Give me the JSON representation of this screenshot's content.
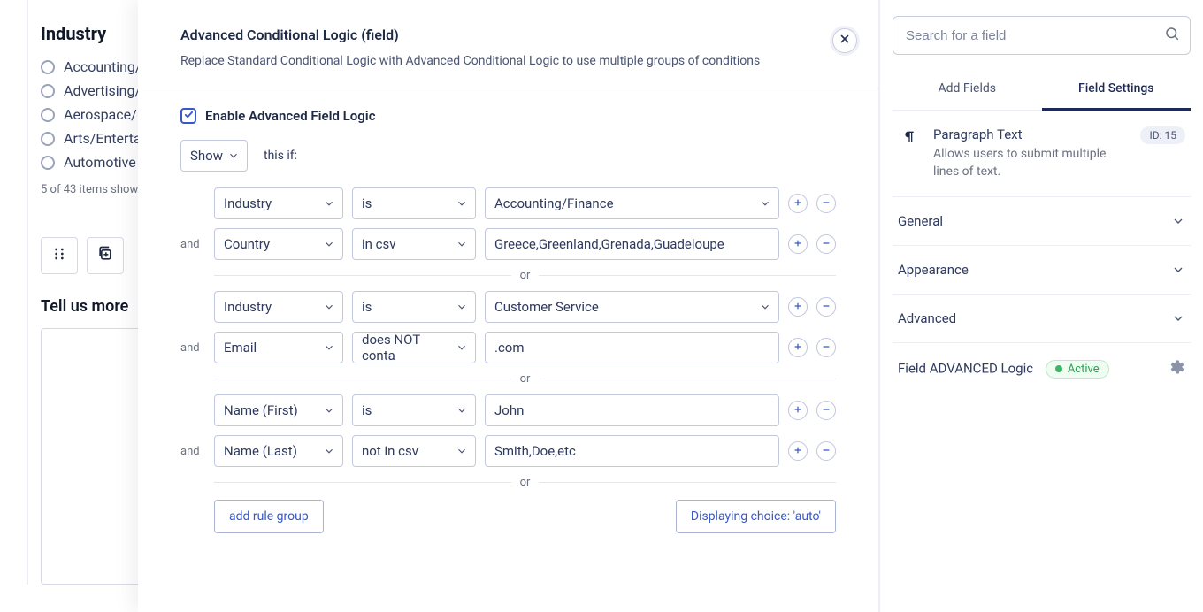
{
  "left": {
    "title": "Industry",
    "options": [
      "Accounting/",
      "Advertising/",
      "Aerospace/",
      "Arts/Enterta",
      "Automotive"
    ],
    "items_shown": "5 of 43 items shown.",
    "tell_more": "Tell us more"
  },
  "modal": {
    "title": "Advanced Conditional Logic (field)",
    "subtitle": "Replace Standard Conditional Logic with Advanced Conditional Logic to use multiple groups of conditions",
    "enable_label": "Enable Advanced Field Logic",
    "show_label": "Show",
    "this_if": "this if:",
    "and_label": "and",
    "or_label": "or",
    "rules": [
      {
        "field": "Industry",
        "op": "is",
        "value": "Accounting/Finance",
        "value_type": "select"
      },
      {
        "field": "Country",
        "op": "in csv",
        "value": "Greece,Greenland,Grenada,Guadeloupe",
        "value_type": "text",
        "and": true
      },
      {
        "field": "Industry",
        "op": "is",
        "value": "Customer Service",
        "value_type": "select"
      },
      {
        "field": "Email",
        "op": "does NOT conta",
        "value": ".com",
        "value_type": "text",
        "and": true
      },
      {
        "field": "Name (First)",
        "op": "is",
        "value": "John",
        "value_type": "text"
      },
      {
        "field": "Name (Last)",
        "op": "not in csv",
        "value": "Smith,Doe,etc",
        "value_type": "text",
        "and": true
      }
    ],
    "add_rule_group": "add rule group",
    "display_choice": "Displaying choice: 'auto'"
  },
  "right": {
    "search_placeholder": "Search for a field",
    "tabs": {
      "add": "Add Fields",
      "settings": "Field Settings"
    },
    "field": {
      "title": "Paragraph Text",
      "desc": "Allows users to submit multiple lines of text.",
      "id_badge": "ID: 15"
    },
    "sections": {
      "general": "General",
      "appearance": "Appearance",
      "advanced": "Advanced",
      "adv_logic": "Field ADVANCED Logic",
      "active": "Active"
    }
  }
}
